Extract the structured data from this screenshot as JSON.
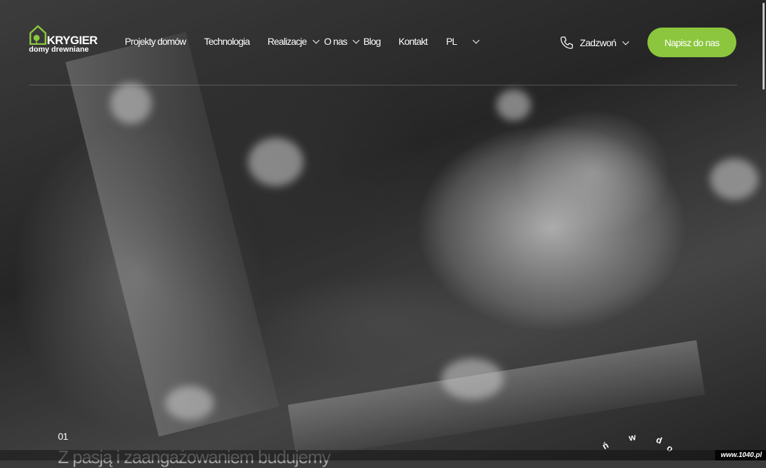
{
  "brand": {
    "name": "KRYGIER",
    "tagline": "domy drewniane",
    "accent_color": "#8cc63f"
  },
  "nav": {
    "items": [
      {
        "label": "Projekty domów",
        "has_dropdown": false
      },
      {
        "label": "Technologia",
        "has_dropdown": false
      },
      {
        "label": "Realizacje",
        "has_dropdown": true
      },
      {
        "label": "O nas",
        "has_dropdown": true
      },
      {
        "label": "Blog",
        "has_dropdown": false
      },
      {
        "label": "Kontakt",
        "has_dropdown": false
      }
    ],
    "language": "PL"
  },
  "header_actions": {
    "phone_label": "Zadzwoń",
    "phone_icon": "phone-icon",
    "cta_label": "Napisz do nas"
  },
  "hero": {
    "slide_number": "01",
    "headline": "Z pasją i zaangażowaniem budujemy",
    "rotating_letters": [
      "ń",
      "w",
      "d",
      "o"
    ]
  },
  "watermark": "www.1040.pl"
}
